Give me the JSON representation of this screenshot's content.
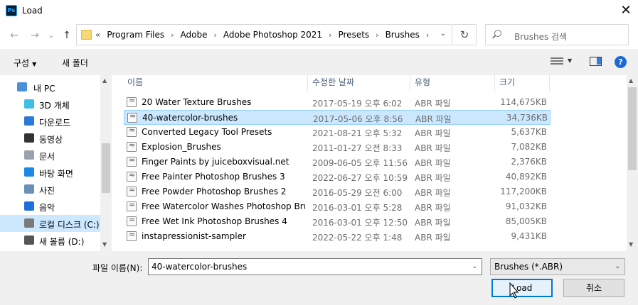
{
  "window": {
    "app_icon": "ps-app-icon",
    "app_icon_text": "Ps",
    "title": "Load",
    "close_label": "✕"
  },
  "nav": {
    "back_icon": "←",
    "forward_icon": "→",
    "recent_icon": "⌄",
    "up_icon": "↑",
    "crumb_overflow": "«",
    "breadcrumbs": [
      "Program Files",
      "Adobe",
      "Adobe Photoshop 2021",
      "Presets",
      "Brushes"
    ],
    "crumb_sep": "›",
    "refresh_icon": "↻",
    "search_placeholder": "Brushes 검색"
  },
  "toolbar": {
    "organize_label": "구성",
    "new_folder_label": "새 폴더",
    "help_label": "?"
  },
  "sidebar": {
    "items": [
      {
        "label": "내 PC",
        "icon": "pc-icon",
        "color": "#4a90d9"
      },
      {
        "label": "3D 개체",
        "icon": "3d-objects-icon",
        "color": "#3cc0e6"
      },
      {
        "label": "다운로드",
        "icon": "download-icon",
        "color": "#2a7ad6"
      },
      {
        "label": "동영상",
        "icon": "video-icon",
        "color": "#333333"
      },
      {
        "label": "문서",
        "icon": "document-icon",
        "color": "#9aa3ad"
      },
      {
        "label": "바탕 화면",
        "icon": "desktop-icon",
        "color": "#1e88e5"
      },
      {
        "label": "사진",
        "icon": "pictures-icon",
        "color": "#6b8fb5"
      },
      {
        "label": "음악",
        "icon": "music-icon",
        "color": "#1e6fd9"
      },
      {
        "label": "로컬 디스크 (C:)",
        "icon": "local-disk-icon",
        "color": "#7a7a7a",
        "selected": true
      },
      {
        "label": "새 볼륨 (D:)",
        "icon": "volume-icon",
        "color": "#555555"
      }
    ]
  },
  "columns": {
    "name": "이름",
    "date": "수정한 날짜",
    "type": "유형",
    "size": "크기"
  },
  "files": [
    {
      "name": "20 Water Texture Brushes",
      "date": "2017-05-19 오후 6:02",
      "type": "ABR 파일",
      "size": "114,675KB"
    },
    {
      "name": "40-watercolor-brushes",
      "date": "2017-05-06 오후 8:56",
      "type": "ABR 파일",
      "size": "34,736KB",
      "selected": true
    },
    {
      "name": "Converted Legacy Tool Presets",
      "date": "2021-08-21 오후 5:32",
      "type": "ABR 파일",
      "size": "5,637KB"
    },
    {
      "name": "Explosion_Brushes",
      "date": "2011-01-27 오전 8:33",
      "type": "ABR 파일",
      "size": "7,082KB"
    },
    {
      "name": "Finger Paints by juiceboxvisual.net",
      "date": "2009-06-05 오후 11:56",
      "type": "ABR 파일",
      "size": "2,376KB"
    },
    {
      "name": "Free Painter Photoshop Brushes 3",
      "date": "2022-06-27 오후 10:59",
      "type": "ABR 파일",
      "size": "40,892KB"
    },
    {
      "name": "Free Powder Photoshop Brushes 2",
      "date": "2016-05-29 오전 6:00",
      "type": "ABR 파일",
      "size": "117,200KB"
    },
    {
      "name": "Free Watercolor Washes Photoshop Brus...",
      "date": "2016-03-01 오후 5:28",
      "type": "ABR 파일",
      "size": "91,032KB"
    },
    {
      "name": "Free Wet Ink Photoshop Brushes 4",
      "date": "2016-03-01 오후 12:50",
      "type": "ABR 파일",
      "size": "85,005KB"
    },
    {
      "name": "instapressionist-sampler",
      "date": "2022-05-22 오후 1:48",
      "type": "ABR 파일",
      "size": "9,431KB"
    }
  ],
  "footer": {
    "filename_label": "파일 이름(N):",
    "filename_value": "40-watercolor-brushes",
    "filter_value": "Brushes (*.ABR)",
    "load_label": "Load",
    "cancel_label": "취소"
  }
}
